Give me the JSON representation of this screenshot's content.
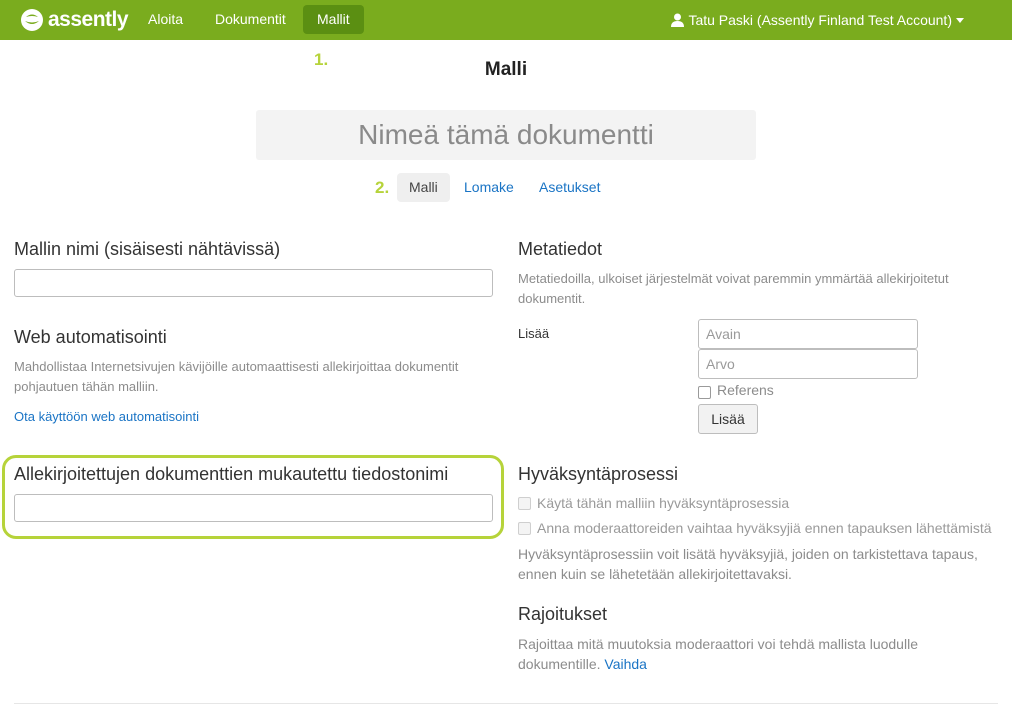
{
  "brand": {
    "name": "assently"
  },
  "nav": {
    "items": [
      {
        "label": "Aloita"
      },
      {
        "label": "Dokumentit"
      },
      {
        "label": "Mallit"
      }
    ],
    "user": "Tatu Paski (Assently Finland Test Account)"
  },
  "steps": {
    "one": "1.",
    "two": "2."
  },
  "page_title": "Malli",
  "document_name": {
    "placeholder": "Nimeä tämä dokumentti",
    "value": ""
  },
  "tabs": [
    {
      "label": "Malli"
    },
    {
      "label": "Lomake"
    },
    {
      "label": "Asetukset"
    }
  ],
  "left": {
    "template_name": {
      "title": "Mallin nimi (sisäisesti nähtävissä)",
      "value": ""
    },
    "web_automation": {
      "title": "Web automatisointi",
      "desc": "Mahdollistaa Internetsivujen kävijöille automaattisesti allekirjoittaa dokumentit pohjautuen tähän malliin.",
      "link": "Ota käyttöön web automatisointi"
    },
    "filename": {
      "title": "Allekirjoitettujen dokumenttien mukautettu tiedostonimi",
      "value": ""
    }
  },
  "right": {
    "metadata": {
      "title": "Metatiedot",
      "desc": "Metatiedoilla, ulkoiset järjestelmät voivat paremmin ymmärtää allekirjoitetut dokumentit.",
      "add_label": "Lisää",
      "key_placeholder": "Avain",
      "value_placeholder": "Arvo",
      "reference_label": "Referens",
      "add_button": "Lisää"
    },
    "approval": {
      "title": "Hyväksyntäprosessi",
      "option1": "Käytä tähän malliin hyväksyntäprosessia",
      "option2": "Anna moderaattoreiden vaihtaa hyväksyjiä ennen tapauksen lähettämistä",
      "desc": "Hyväksyntäprosessiin voit lisätä hyväksyjiä, joiden on tarkistettava tapaus, ennen kuin se lähetetään allekirjoitettavaksi."
    },
    "restrictions": {
      "title": "Rajoitukset",
      "desc": "Rajoittaa mitä muutoksia moderaattori voi tehdä mallista luodulle dokumentille.",
      "link": "Vaihda"
    }
  },
  "colors": {
    "navbar": "#7aac1e",
    "nav_active": "#5b8f12",
    "highlight": "#b6d33a",
    "link": "#1a74c5"
  },
  "icons": {
    "logo": "assently-logo-icon",
    "user": "user-icon",
    "caret": "caret-down-icon"
  }
}
